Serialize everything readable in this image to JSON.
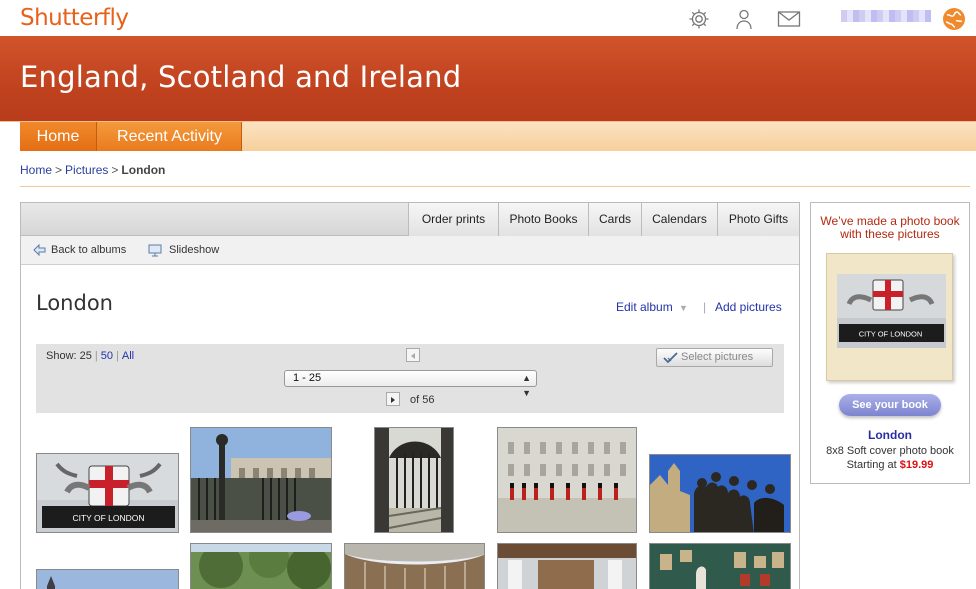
{
  "header": {
    "logo": "Shutterfly",
    "username": ""
  },
  "banner": {
    "title": "England, Scotland and Ireland"
  },
  "nav": {
    "items": [
      "Home",
      "Recent Activity"
    ]
  },
  "breadcrumb": {
    "home": "Home",
    "sep": ">",
    "pictures": "Pictures",
    "current": "London"
  },
  "tabs": [
    "Order prints",
    "Photo Books",
    "Cards",
    "Calendars",
    "Photo Gifts"
  ],
  "toolbar": {
    "back": "Back to albums",
    "slideshow": "Slideshow"
  },
  "album": {
    "title": "London",
    "edit": "Edit album",
    "add": "Add pictures"
  },
  "pager": {
    "show_label": "Show:",
    "show_25": "25",
    "show_50": "50",
    "show_all": "All",
    "range": "1 - 25",
    "of": "of 56",
    "select": "Select pictures"
  },
  "photos": [
    {
      "label": "CITY OF LONDON"
    },
    {
      "label": ""
    },
    {
      "label": ""
    },
    {
      "label": ""
    },
    {
      "label": ""
    }
  ],
  "promo": {
    "heading": "We’ve made a photo book with these pictures",
    "book_label": "CITY OF LONDON",
    "button": "See your book",
    "title": "London",
    "desc": "8x8 Soft cover photo book",
    "starting": "Starting at",
    "price": "$19.99"
  },
  "colors": {
    "brand": "#e8611a",
    "banner": "#c0421f",
    "link": "#2233aa",
    "price": "#e01010"
  }
}
